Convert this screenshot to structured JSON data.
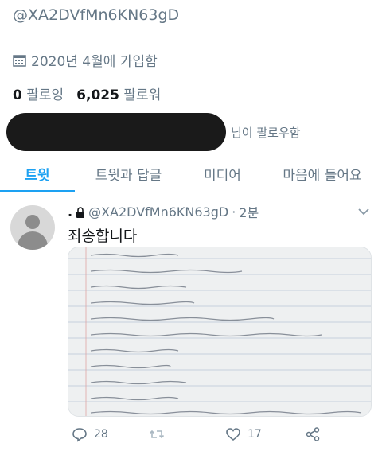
{
  "profile": {
    "handle": "@XA2DVfMn6KN63gD",
    "joined": "2020년 4월에 가입함",
    "following_count": "0",
    "following_label": "팔로잉",
    "followers_count": "6,025",
    "followers_label": "팔로워",
    "followed_by_suffix": "님이 팔로우함"
  },
  "tabs": [
    {
      "label": "트윗",
      "active": true
    },
    {
      "label": "트윗과 답글",
      "active": false
    },
    {
      "label": "미디어",
      "active": false
    },
    {
      "label": "마음에 들어요",
      "active": false
    }
  ],
  "tweet": {
    "prefix": ".",
    "handle": "@XA2DVfMn6KN63gD",
    "separator": "·",
    "time": "2분",
    "text": "죄송합니다",
    "reply_count": "28",
    "retweet_count": "",
    "like_count": "17"
  },
  "colors": {
    "accent": "#1da1f2",
    "secondary_text": "#657786",
    "primary_text": "#14171a"
  },
  "icons": [
    "calendar-icon",
    "lock-icon",
    "chevron-down-icon",
    "reply-icon",
    "retweet-icon",
    "like-icon",
    "share-icon"
  ]
}
